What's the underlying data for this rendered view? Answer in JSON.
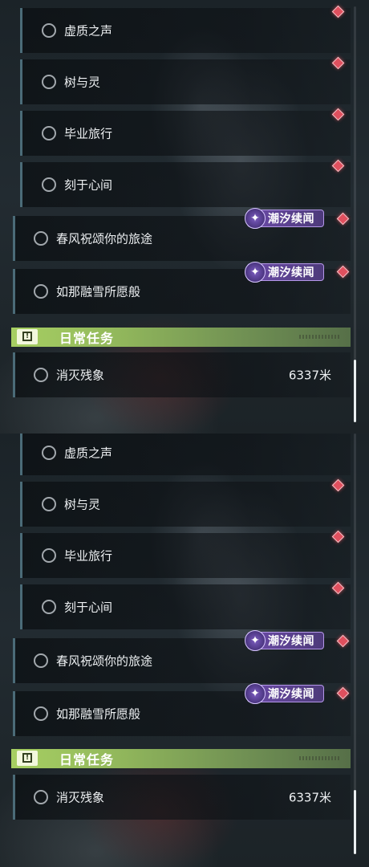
{
  "quest_list": {
    "sub_quests": [
      {
        "label": "虚质之声"
      },
      {
        "label": "树与灵"
      },
      {
        "label": "毕业旅行"
      },
      {
        "label": "刻于心间"
      }
    ],
    "main_quests": [
      {
        "label": "春风祝颂你的旅途",
        "tag": "潮汐续闻"
      },
      {
        "label": "如那融雪所愿般",
        "tag": "潮汐续闻"
      }
    ],
    "daily_section": {
      "title": "日常任务",
      "quests": [
        {
          "label": "消灭残象",
          "distance": "6337米"
        }
      ]
    }
  },
  "tag_icon": "sparkle-icon",
  "section_icon": "exclamation-icon",
  "colors": {
    "accent_green": "#a7cf62",
    "tracker_red": "#e0505e",
    "tag_purple": "#6c4ba8"
  }
}
